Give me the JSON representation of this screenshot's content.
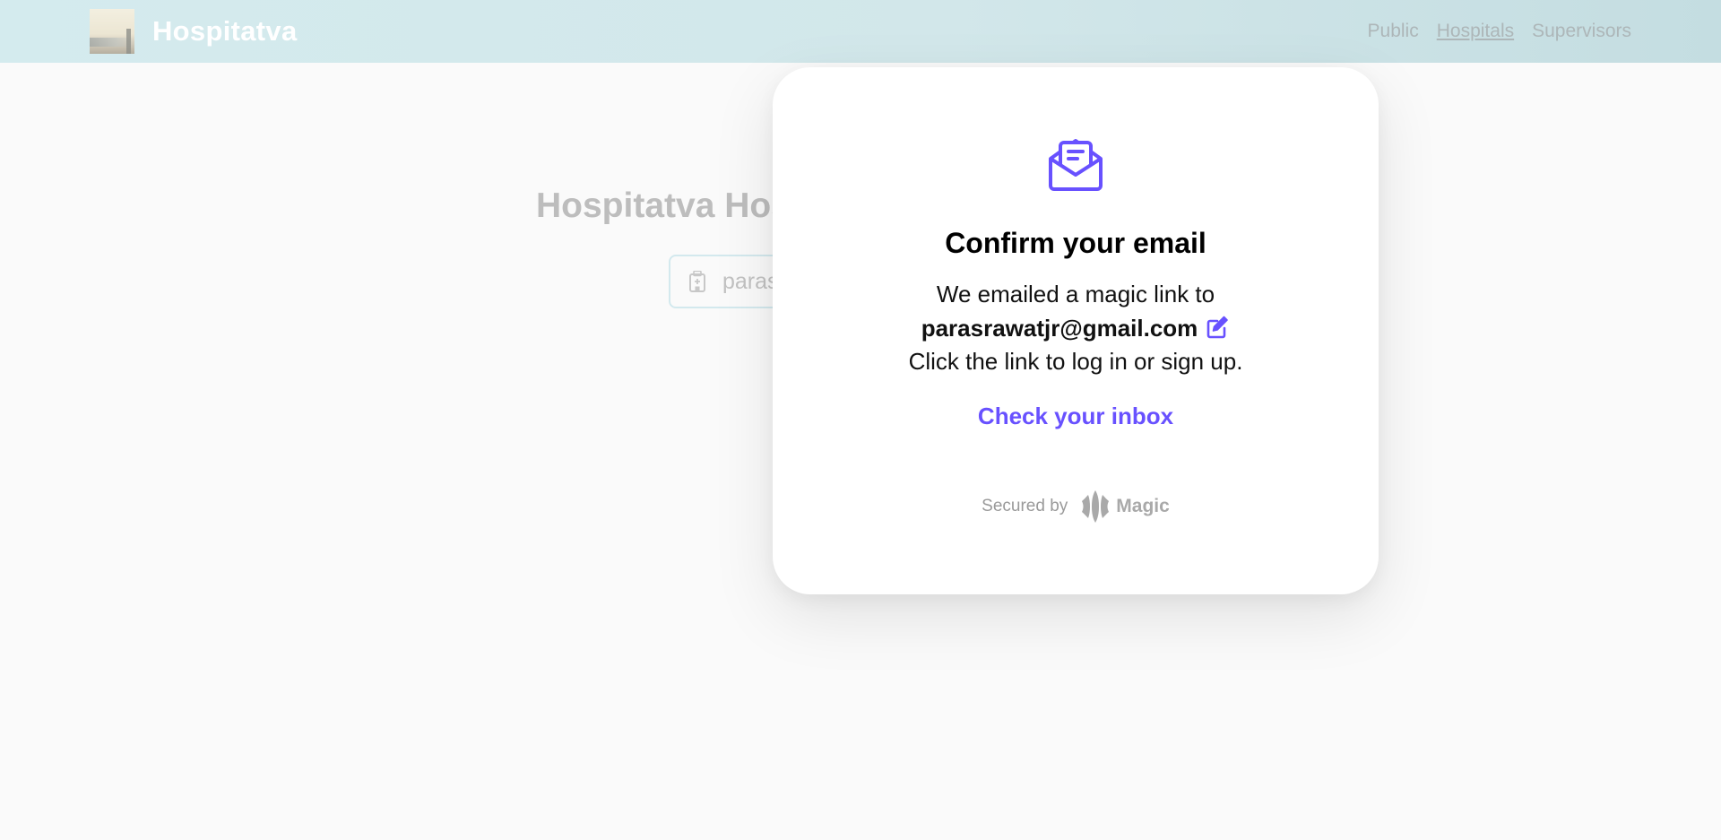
{
  "app": {
    "brand_name": "Hospitatva",
    "nav": [
      {
        "label": "Public"
      },
      {
        "label": "Hospitals",
        "active": true
      },
      {
        "label": "Supervisors"
      }
    ]
  },
  "background": {
    "title": "Hospitatva Hos",
    "search": {
      "value": "paras",
      "icon": "hospital-icon"
    }
  },
  "modal": {
    "icon": "open-envelope-icon",
    "title": "Confirm your email",
    "line1": "We emailed a magic link to",
    "email": "parasrawatjr@gmail.com",
    "edit_icon": "edit-icon",
    "line3": "Click the link to log in or sign up.",
    "inbox_link": "Check your inbox",
    "secured_by": "Secured by",
    "provider": "Magic"
  },
  "colors": {
    "accent": "#6851ff",
    "navbar": "#d2e7ea",
    "page_bg": "#fafafa"
  }
}
